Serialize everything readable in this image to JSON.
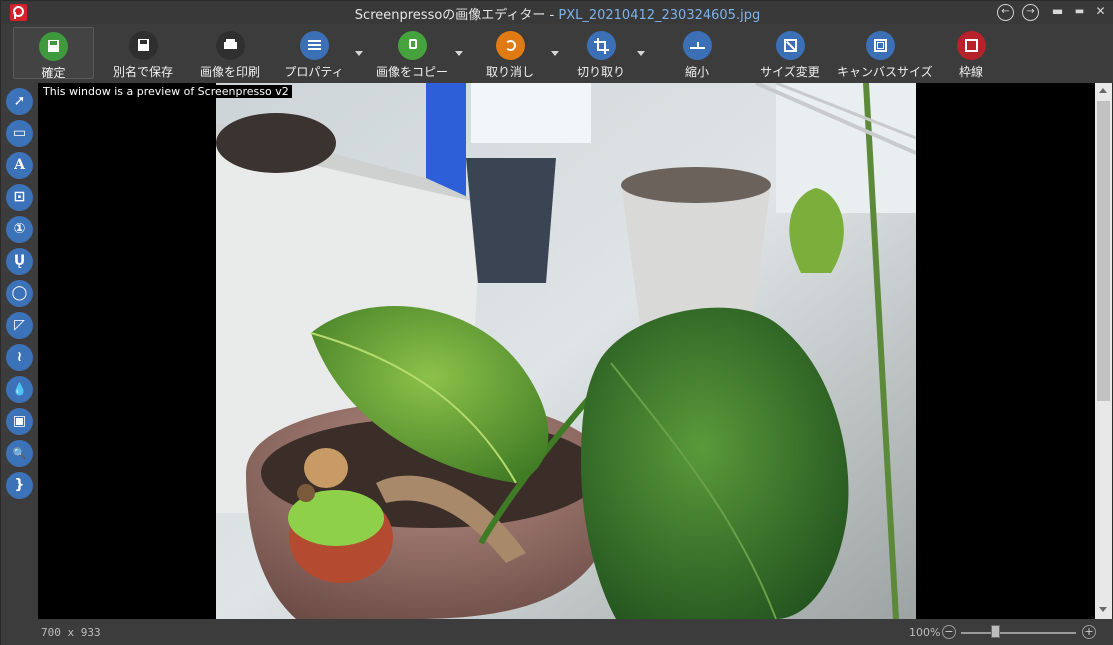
{
  "window": {
    "title_app": "Screenpressoの画像エディター",
    "title_sep": " - ",
    "title_file": "PXL_20210412_230324605.jpg"
  },
  "toolbar": {
    "buttons": [
      {
        "label": "確定",
        "icon": "save-icon",
        "color": "#3e9a3c"
      },
      {
        "label": "別名で保存",
        "icon": "save-as-icon",
        "color": "#2f2f2f"
      },
      {
        "label": "画像を印刷",
        "icon": "print-icon",
        "color": "#2f2f2f"
      },
      {
        "label": "プロパティ",
        "icon": "list-icon",
        "color": "#3b70b6"
      },
      {
        "label": "画像をコピー",
        "icon": "copy-icon",
        "color": "#45a23d"
      },
      {
        "label": "取り消し",
        "icon": "undo-icon",
        "color": "#e07b13"
      },
      {
        "label": "切り取り",
        "icon": "crop-icon",
        "color": "#3b70b6"
      },
      {
        "label": "縮小",
        "icon": "shrink-icon",
        "color": "#3b70b6"
      },
      {
        "label": "サイズ変更",
        "icon": "resize-icon",
        "color": "#3b70b6"
      },
      {
        "label": "キャンバスサイズ",
        "icon": "canvas-size-icon",
        "color": "#3b70b6"
      },
      {
        "label": "枠線",
        "icon": "border-icon",
        "color": "#b8202a"
      }
    ]
  },
  "sidebar": {
    "tools": [
      {
        "glyph": "➚",
        "icon": "arrow-tool-icon"
      },
      {
        "glyph": "▭",
        "icon": "rectangle-tool-icon"
      },
      {
        "glyph": "A",
        "icon": "text-tool-icon"
      },
      {
        "glyph": "⊡",
        "icon": "callout-tool-icon"
      },
      {
        "glyph": "①",
        "icon": "numbering-tool-icon"
      },
      {
        "glyph": "Ų",
        "icon": "magnet-tool-icon"
      },
      {
        "glyph": "◯",
        "icon": "ellipse-tool-icon"
      },
      {
        "glyph": "◸",
        "icon": "polygon-tool-icon"
      },
      {
        "glyph": "≀",
        "icon": "freehand-tool-icon"
      },
      {
        "glyph": "💧",
        "icon": "blur-tool-icon"
      },
      {
        "glyph": "▣",
        "icon": "image-tool-icon"
      },
      {
        "glyph": "🔍",
        "icon": "magnifier-tool-icon"
      },
      {
        "glyph": "}",
        "icon": "bracket-tool-icon"
      }
    ]
  },
  "canvas": {
    "preview_note": "This window is a preview of Screenpresso v2"
  },
  "status": {
    "dimensions": "700 x 933",
    "zoom": "100%",
    "zoom_minus": "−",
    "zoom_plus": "+"
  }
}
